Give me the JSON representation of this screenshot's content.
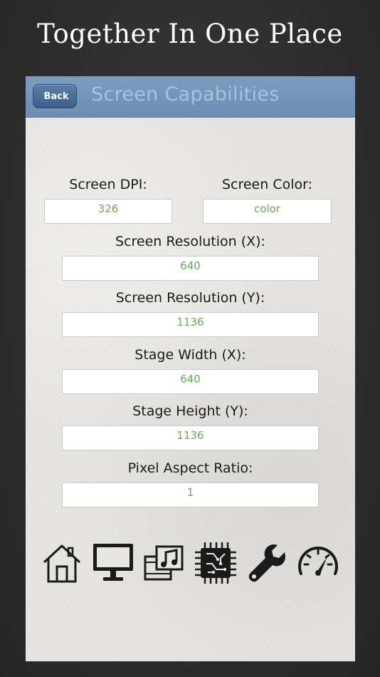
{
  "headline": "Together In One Place",
  "nav": {
    "back_label": "Back",
    "title": "Screen Capabilities"
  },
  "fields": {
    "screen_dpi": {
      "label": "Screen DPI:",
      "value": "326"
    },
    "screen_color": {
      "label": "Screen Color:",
      "value": "color"
    },
    "resolution_x": {
      "label": "Screen Resolution (X):",
      "value": "640"
    },
    "resolution_y": {
      "label": "Screen Resolution (Y):",
      "value": "1136"
    },
    "stage_width": {
      "label": "Stage Width (X):",
      "value": "640"
    },
    "stage_height": {
      "label": "Stage Height (Y):",
      "value": "1136"
    },
    "pixel_aspect": {
      "label": "Pixel Aspect Ratio:",
      "value": "1"
    }
  },
  "toolbar": {
    "icons": [
      "home-icon",
      "monitor-icon",
      "media-icon",
      "cpu-chip-icon",
      "wrench-icon",
      "speedometer-icon"
    ]
  },
  "colors": {
    "navbar": "#7596bb",
    "nav_title": "#a9c3de",
    "value_text": "#6aa84f",
    "background": "#2f2f2f"
  }
}
